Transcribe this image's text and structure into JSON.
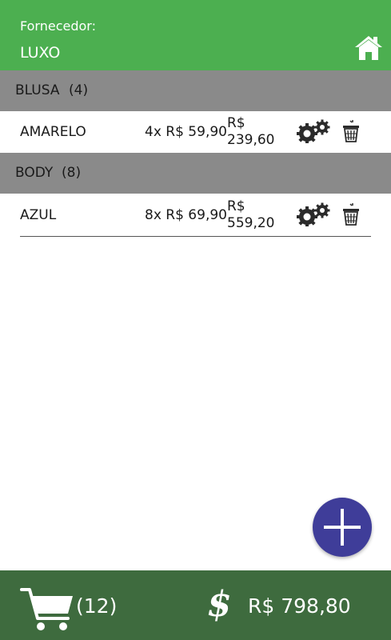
{
  "header": {
    "supplier_label": "Fornecedor:",
    "supplier_name": "LUXO",
    "home_icon": "home-icon"
  },
  "groups": [
    {
      "name": "BLUSA",
      "count": "(4)",
      "items": [
        {
          "name": "AMARELO",
          "qty_price": "4x R$ 59,90",
          "total_currency": "R$",
          "total_value": "239,60"
        }
      ]
    },
    {
      "name": "BODY",
      "count": "(8)",
      "items": [
        {
          "name": "AZUL",
          "qty_price": "8x R$ 69,90",
          "total_currency": "R$",
          "total_value": "559,20"
        }
      ]
    }
  ],
  "footer": {
    "cart_count": "(12)",
    "currency_symbol": "$",
    "total": "R$ 798,80"
  },
  "colors": {
    "header_green": "#4caf50",
    "group_gray": "#8a8a8a",
    "footer_green": "#3e6b3e",
    "fab_blue": "#3f3d99"
  }
}
